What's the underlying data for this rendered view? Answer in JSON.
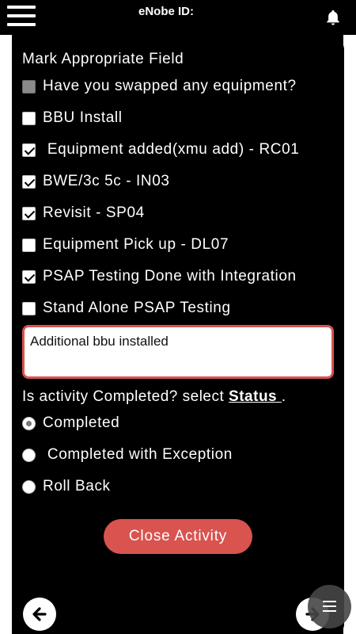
{
  "header": {
    "title": "eNobe ID:",
    "menu_icon": "hamburger-menu-icon",
    "bell_icon": "bell-icon"
  },
  "form": {
    "heading": "Mark Appropriate Field",
    "checkboxes": [
      {
        "label": "Have you swapped any equipment?",
        "checked": false,
        "disabled": true
      },
      {
        "label": "BBU Install",
        "checked": false,
        "disabled": false
      },
      {
        "label": " Equipment added(xmu add) - RC01",
        "checked": true,
        "disabled": false
      },
      {
        "label": "BWE/3c 5c - IN03",
        "checked": true,
        "disabled": false
      },
      {
        "label": "Revisit - SP04",
        "checked": true,
        "disabled": false
      },
      {
        "label": "Equipment Pick up - DL07",
        "checked": false,
        "disabled": false
      },
      {
        "label": "PSAP Testing Done with Integration",
        "checked": true,
        "disabled": false
      },
      {
        "label": "Stand Alone PSAP Testing",
        "checked": false,
        "disabled": false
      }
    ],
    "note_value": "Additional bbu installed",
    "status_question": "Is activity Completed? select ",
    "status_link": "Status ",
    "status_suffix": ".",
    "radios": [
      {
        "label": "Completed",
        "selected": true
      },
      {
        "label": " Completed with Exception",
        "selected": false
      },
      {
        "label": "Roll Back",
        "selected": false
      }
    ],
    "close_button": "Close Activity"
  },
  "footer": {
    "back_icon": "arrow-left-icon",
    "next_icon": "arrow-right-icon",
    "menu_fab_icon": "menu-lines-icon"
  },
  "colors": {
    "accent": "#d9534f",
    "background": "#000000",
    "text": "#ffffff"
  }
}
